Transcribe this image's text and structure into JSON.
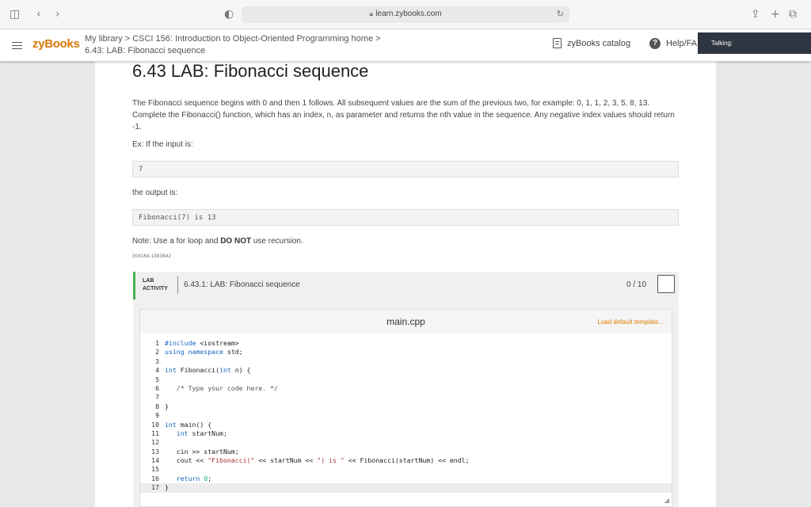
{
  "browser": {
    "url": "learn.zybooks.com"
  },
  "header": {
    "logo": "zyBooks",
    "breadcrumb_line1": "My library > CSCI 156: Introduction to Object-Oriented Programming home >",
    "breadcrumb_line2": "6.43: LAB: Fibonacci sequence",
    "catalog_label": "zyBooks catalog",
    "help_label": "Help/FA",
    "talking_label": "Talking:"
  },
  "content": {
    "title": "6.43 LAB: Fibonacci sequence",
    "description": "The Fibonacci sequence begins with 0 and then 1 follows. All subsequent values are the sum of the previous two, for example: 0, 1, 1, 2, 3, 5, 8, 13. Complete the Fibonacci() function, which has an index, n, as parameter and returns the nth value in the sequence. Any negative index values should return -1.",
    "example_label": "Ex: If the input is:",
    "example_input": "7",
    "output_label": "the output is:",
    "example_output": "Fibonacci(7) is 13",
    "note_prefix": "Note: Use a for loop and ",
    "note_bold": "DO NOT",
    "note_suffix": " use recursion.",
    "small_id": "304164.1383842"
  },
  "lab": {
    "tag_line1": "LAB",
    "tag_line2": "ACTIVITY",
    "title": "6.43.1: LAB: Fibonacci sequence",
    "score": "0 / 10"
  },
  "editor": {
    "filename": "main.cpp",
    "load_default": "Load default template...",
    "lines": [
      "#include <iostream>",
      "using namespace std;",
      "",
      "int Fibonacci(int n) {",
      "",
      "   /* Type your code here. */",
      "",
      "}",
      "",
      "int main() {",
      "   int startNum;",
      "",
      "   cin >> startNum;",
      "   cout << \"Fibonacci(\" << startNum << \") is \" << Fibonacci(startNum) << endl;",
      "",
      "   return 0;",
      "}"
    ]
  }
}
